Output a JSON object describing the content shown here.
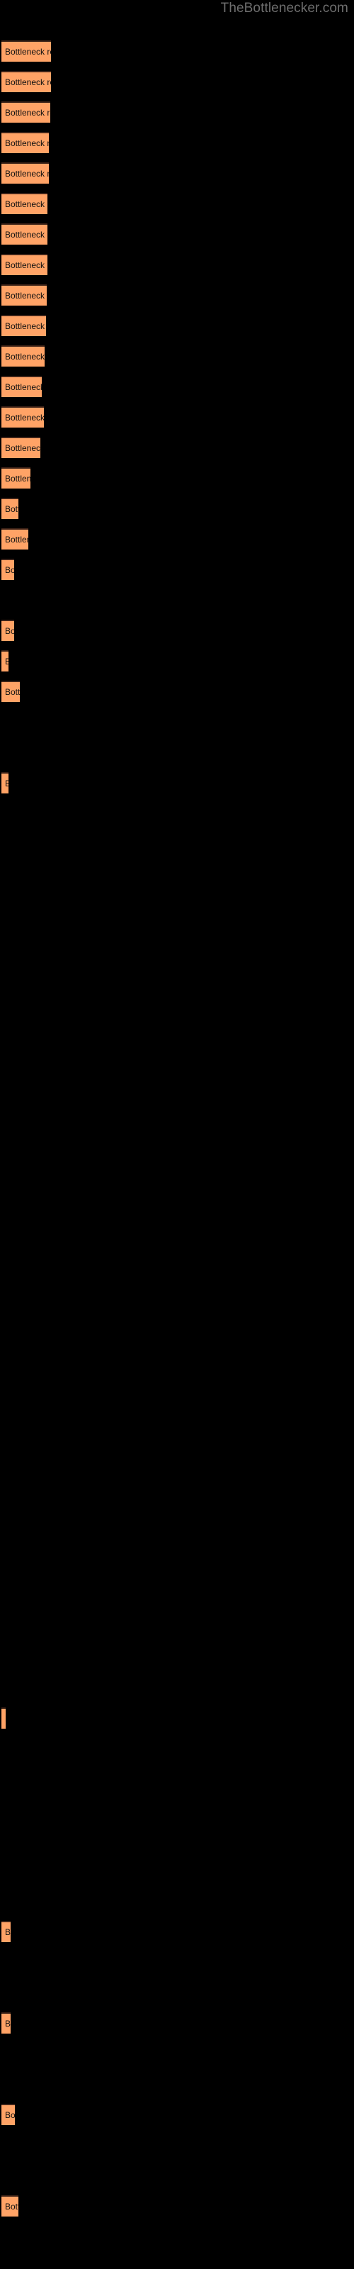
{
  "watermark": {
    "text": "TheBottlenecker.com",
    "color": "#6e6e6e"
  },
  "colors": {
    "background": "#000000",
    "bar_fill": "#ffa366",
    "bar_edge": "#3d2318",
    "label_text": "#111111",
    "watermark_text": "#6e6e6e"
  },
  "chart_data": {
    "type": "bar",
    "orientation": "horizontal",
    "title": "",
    "subtitle": "",
    "xlabel": "",
    "ylabel": "",
    "grid": false,
    "legend": null,
    "axis_visible": false,
    "tick_labels_visible": false,
    "xlim": [
      0,
      500
    ],
    "bar_label_text": "Bottleneck result",
    "categories": [
      "Bottleneck result",
      "Bottleneck result",
      "Bottleneck result",
      "Bottleneck result",
      "Bottleneck result",
      "Bottleneck result",
      "Bottleneck result",
      "Bottleneck result",
      "Bottleneck result",
      "Bottleneck result",
      "Bottleneck result",
      "Bottleneck result",
      "Bottleneck result",
      "Bottleneck result",
      "Bottleneck result",
      "Bottleneck result",
      "Bottleneck result",
      "Bottleneck result",
      "Bottleneck result",
      "Bottleneck result",
      "Bottleneck result",
      "Bottleneck result",
      "Bottleneck result",
      "Bottleneck result",
      "Bottleneck result",
      "Bottleneck result",
      "Bottleneck result",
      "Bottleneck result"
    ],
    "bars": [
      {
        "y": 57,
        "width": 70,
        "label": "Bottleneck result"
      },
      {
        "y": 100,
        "width": 70,
        "label": "Bottleneck result"
      },
      {
        "y": 143,
        "width": 69,
        "label": "Bottleneck result"
      },
      {
        "y": 186,
        "width": 67,
        "label": "Bottleneck result"
      },
      {
        "y": 229,
        "width": 67,
        "label": "Bottleneck result"
      },
      {
        "y": 272,
        "width": 65,
        "label": "Bottleneck result"
      },
      {
        "y": 315,
        "width": 65,
        "label": "Bottleneck result"
      },
      {
        "y": 358,
        "width": 65,
        "label": "Bottleneck result"
      },
      {
        "y": 401,
        "width": 64,
        "label": "Bottleneck result"
      },
      {
        "y": 444,
        "width": 63,
        "label": "Bottleneck result"
      },
      {
        "y": 487,
        "width": 61,
        "label": "Bottleneck result"
      },
      {
        "y": 530,
        "width": 57,
        "label": "Bottleneck result"
      },
      {
        "y": 573,
        "width": 60,
        "label": "Bottleneck result"
      },
      {
        "y": 616,
        "width": 55,
        "label": "Bottleneck result"
      },
      {
        "y": 659,
        "width": 41,
        "label": "Bottleneck result"
      },
      {
        "y": 702,
        "width": 24,
        "label": "Bottleneck result"
      },
      {
        "y": 745,
        "width": 38,
        "label": "Bottleneck result"
      },
      {
        "y": 788,
        "width": 18,
        "label": "Bottleneck result"
      },
      {
        "y": 874,
        "width": 18,
        "label": "Bottleneck result"
      },
      {
        "y": 917,
        "width": 10,
        "label": "Bottleneck result"
      },
      {
        "y": 960,
        "width": 26,
        "label": "Bottleneck result"
      },
      {
        "y": 1089,
        "width": 10,
        "label": "Bottleneck result"
      },
      {
        "y": 2408,
        "width": 6,
        "label": "Bottleneck result"
      },
      {
        "y": 2709,
        "width": 13,
        "label": "Bottleneck result"
      },
      {
        "y": 2838,
        "width": 13,
        "label": "Bottleneck result"
      },
      {
        "y": 2967,
        "width": 19,
        "label": "Bottleneck result"
      },
      {
        "y": 3096,
        "width": 24,
        "label": "Bottleneck result"
      }
    ]
  }
}
